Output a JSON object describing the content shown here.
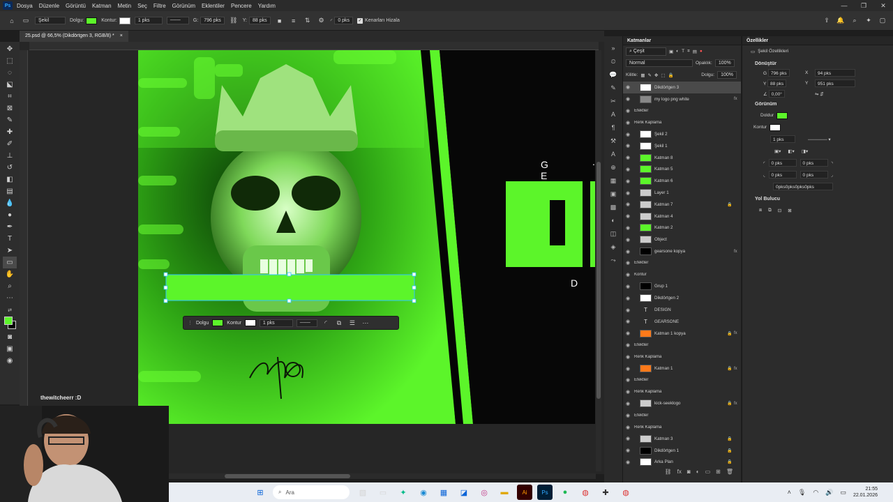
{
  "app": {
    "logo": "Ps"
  },
  "menu": [
    "Dosya",
    "Düzenle",
    "Görüntü",
    "Katman",
    "Metin",
    "Seç",
    "Filtre",
    "Görünüm",
    "Eklentiler",
    "Pencere",
    "Yardım"
  ],
  "options": {
    "shape_mode": "Şekil",
    "fill_label": "Dolgu:",
    "stroke_label": "Kontur:",
    "stroke_width": "1 pks",
    "w_label": "G:",
    "w_value": "796 pks",
    "h_label": "Y:",
    "h_value": "88 pks",
    "radius": "0 pks",
    "align_edges": "Kenarları Hizala",
    "fill_color": "#5cf52a"
  },
  "doc_tab": {
    "title": "25.psd @ 66,5% (Dikdörtgen 3, RGB/8) *",
    "close": "×"
  },
  "canvas": {
    "letters_top": "G E",
    "letter_dot": ".",
    "letter_bottom": "D",
    "accent": "#5cf52a"
  },
  "context_bar": {
    "fill": "Dolgu",
    "stroke": "Kontur",
    "width": "1 pks"
  },
  "streamer": {
    "name": "thewitcheerr :D"
  },
  "layers_panel": {
    "title": "Katmanlar",
    "filter": "Çeşit",
    "blend": "Normal",
    "opacity_label": "Opaklık:",
    "opacity": "100%",
    "lock_label": "Kilitle:",
    "fill_label": "Dolgu:",
    "fill": "100%",
    "layers": [
      {
        "name": "Dikdörtgen 3",
        "selected": true,
        "lock": false,
        "fx": false,
        "thumb": "#ffffff"
      },
      {
        "name": "my logo png white",
        "fx": true,
        "thumb": "#888"
      },
      {
        "name": "Efektler",
        "sub": true
      },
      {
        "name": "Renk Kaplama",
        "sub": true
      },
      {
        "name": "Şekil 2",
        "thumb": "#ffffff"
      },
      {
        "name": "Şekil 1",
        "thumb": "#ffffff"
      },
      {
        "name": "Katman 8",
        "thumb": "#5cf52a"
      },
      {
        "name": "Katman 5",
        "thumb": "#5cf52a"
      },
      {
        "name": "Katman 6",
        "thumb": "#5cf52a"
      },
      {
        "name": "Layer 1",
        "thumb": "#ccc"
      },
      {
        "name": "Katman 7",
        "lock": true,
        "thumb": "#ccc"
      },
      {
        "name": "Katman 4",
        "thumb": "#ccc"
      },
      {
        "name": "Katman 2",
        "thumb": "#5cf52a"
      },
      {
        "name": "Object",
        "thumb": "#ccc"
      },
      {
        "name": "gearsone kopya",
        "fx": true,
        "thumb": "#000"
      },
      {
        "name": "Efektler",
        "sub": true
      },
      {
        "name": "Kontur",
        "sub": true
      },
      {
        "name": "Grup 1",
        "thumb": "#000"
      },
      {
        "name": "Dikdörtgen 2",
        "thumb": "#fff"
      },
      {
        "name": "DESIGN",
        "thumb": "T"
      },
      {
        "name": "GEARSONE",
        "thumb": "T"
      },
      {
        "name": "Katman 1 kopya",
        "lock": true,
        "fx": true,
        "thumb": "#ff7a1a"
      },
      {
        "name": "Efektler",
        "sub": true
      },
      {
        "name": "Renk Kaplama",
        "sub": true
      },
      {
        "name": "Katman 1",
        "lock": true,
        "fx": true,
        "thumb": "#ff7a1a"
      },
      {
        "name": "Efektler",
        "sub": true
      },
      {
        "name": "Renk Kaplama",
        "sub": true
      },
      {
        "name": "kick-seeklogo",
        "lock": true,
        "fx": true,
        "thumb": "#ccc"
      },
      {
        "name": "Efektler",
        "sub": true
      },
      {
        "name": "Renk Kaplama",
        "sub": true
      },
      {
        "name": "Katman 3",
        "lock": true,
        "thumb": "#ccc"
      },
      {
        "name": "Dikdörtgen 1",
        "lock": true,
        "thumb": "#000"
      },
      {
        "name": "Arka Plan",
        "lock": true,
        "thumb": "#fff"
      }
    ]
  },
  "properties": {
    "title": "Özellikler",
    "subtitle": "Şekil Özellikleri",
    "transform": "Dönüştür",
    "w": "796 pks",
    "h": "88 pks",
    "x": "94 pks",
    "y": "951 pks",
    "angle": "0,00°",
    "appearance": "Görünüm",
    "fill_label": "Doldur",
    "stroke_label": "Kontur",
    "stroke_width": "1 pks",
    "corner1": "0 pks",
    "corner2": "0 pks",
    "corner3": "0 pks",
    "corner4": "0 pks",
    "corners_all": "0pks0pks0pks0pks",
    "pathfinder": "Yol Bulucu"
  },
  "taskbar": {
    "search": "Ara",
    "time": "21:55",
    "date": "22.01.2026"
  }
}
